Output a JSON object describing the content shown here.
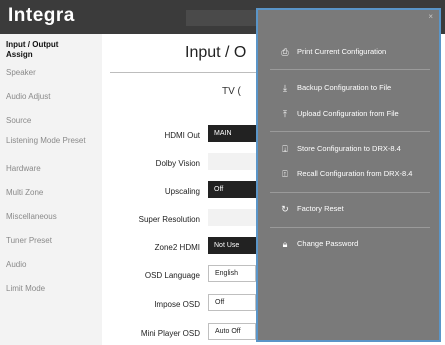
{
  "header": {
    "logo": "Integra"
  },
  "sidebar": {
    "items": [
      {
        "label": "Input / Output Assign"
      },
      {
        "label": "Speaker"
      },
      {
        "label": "Audio Adjust"
      },
      {
        "label": "Source"
      },
      {
        "label": "Listening Mode Preset"
      },
      {
        "label": "Hardware"
      },
      {
        "label": "Multi Zone"
      },
      {
        "label": "Miscellaneous"
      },
      {
        "label": "Tuner Preset"
      },
      {
        "label": "Audio"
      },
      {
        "label": "Limit Mode"
      }
    ]
  },
  "main": {
    "title": "Input / O",
    "section": "TV (",
    "rows": [
      {
        "label": "HDMI Out",
        "value": "MAIN"
      },
      {
        "label": "Dolby Vision",
        "value": ""
      },
      {
        "label": "Upscaling",
        "value": "Off"
      },
      {
        "label": "Super Resolution",
        "value": ""
      },
      {
        "label": "Zone2 HDMI",
        "value": "Not Use"
      },
      {
        "label": "OSD Language",
        "value": "English"
      },
      {
        "label": "Impose OSD",
        "value": "Off"
      },
      {
        "label": "Mini Player OSD",
        "value": "Auto Off"
      }
    ]
  },
  "menu": {
    "close": "×",
    "items": [
      {
        "label": "Print Current Configuration",
        "icon": "printer-icon",
        "glyph": "⎙"
      },
      {
        "label": "Backup Configuration to File",
        "icon": "download-icon",
        "glyph": "⤓"
      },
      {
        "label": "Upload Configuration from File",
        "icon": "upload-icon",
        "glyph": "⤒"
      },
      {
        "label": "Store Configuration to DRX-8.4",
        "icon": "store-device-icon",
        "glyph": "⍗"
      },
      {
        "label": "Recall Configuration from DRX-8.4",
        "icon": "recall-device-icon",
        "glyph": "⍐"
      },
      {
        "label": "Factory Reset",
        "icon": "reset-icon",
        "glyph": "↻"
      },
      {
        "label": "Change Password",
        "icon": "lock-icon",
        "glyph": "🔒︎"
      }
    ]
  },
  "colors": {
    "modal_bg": "#7a7a7a",
    "modal_border": "#5a95c8",
    "topbar": "#3b3b3b"
  }
}
